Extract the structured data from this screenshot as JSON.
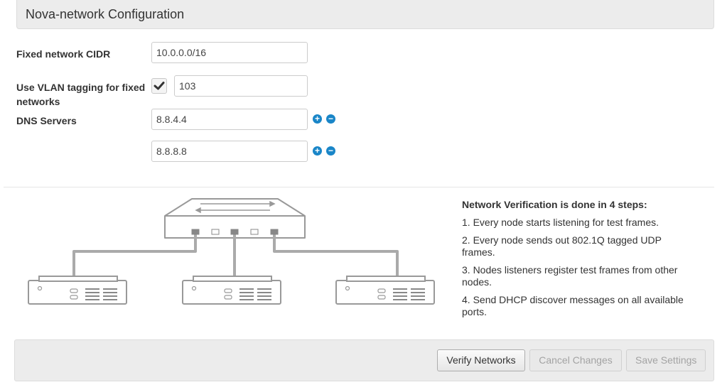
{
  "header": {
    "title": "Nova-network Configuration"
  },
  "fields": {
    "cidr": {
      "label": "Fixed network CIDR",
      "value": "10.0.0.0/16"
    },
    "vlan": {
      "label_line1": "Use VLAN tagging for fixed",
      "label_line2": "networks",
      "checked": true,
      "value": "103"
    },
    "dns": {
      "label": "DNS Servers",
      "servers": [
        "8.8.4.4",
        "8.8.8.8"
      ]
    }
  },
  "icons": {
    "add": "plus-circle-icon",
    "remove": "minus-circle-icon",
    "check": "checkmark-icon"
  },
  "verification": {
    "title": "Network Verification is done in 4 steps:",
    "steps": [
      "1. Every node starts listening for test frames.",
      "2. Every node sends out 802.1Q tagged UDP frames.",
      "3. Nodes listeners register test frames from other nodes.",
      "4. Send DHCP discover messages on all available ports."
    ]
  },
  "footer": {
    "verify_label": "Verify Networks",
    "cancel_label": "Cancel Changes",
    "save_label": "Save Settings"
  },
  "colors": {
    "accent": "#1a86c8",
    "panel": "#ececec",
    "diagram_line": "#999999"
  }
}
